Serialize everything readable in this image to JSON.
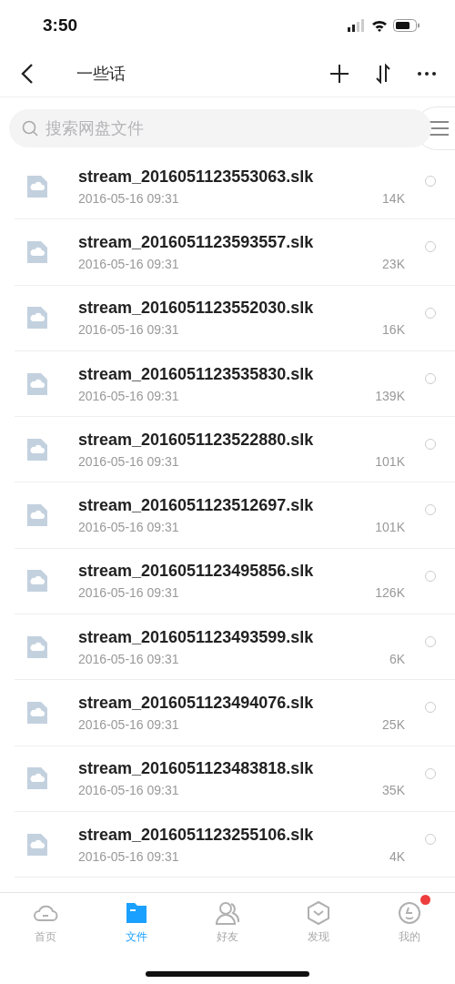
{
  "status_bar": {
    "time": "3:50"
  },
  "nav_bar": {
    "title": "一些话"
  },
  "search": {
    "placeholder": "搜索网盘文件"
  },
  "files": [
    {
      "name": "stream_2016051123553063.slk",
      "date": "2016-05-16 09:31",
      "size": "14K",
      "selected": false
    },
    {
      "name": "stream_2016051123593557.slk",
      "date": "2016-05-16 09:31",
      "size": "23K",
      "selected": false
    },
    {
      "name": "stream_2016051123552030.slk",
      "date": "2016-05-16 09:31",
      "size": "16K",
      "selected": false
    },
    {
      "name": "stream_2016051123535830.slk",
      "date": "2016-05-16 09:31",
      "size": "139K",
      "selected": false
    },
    {
      "name": "stream_2016051123522880.slk",
      "date": "2016-05-16 09:31",
      "size": "101K",
      "selected": false
    },
    {
      "name": "stream_2016051123512697.slk",
      "date": "2016-05-16 09:31",
      "size": "101K",
      "selected": false
    },
    {
      "name": "stream_2016051123495856.slk",
      "date": "2016-05-16 09:31",
      "size": "126K",
      "selected": false
    },
    {
      "name": "stream_2016051123493599.slk",
      "date": "2016-05-16 09:31",
      "size": "6K",
      "selected": false
    },
    {
      "name": "stream_2016051123494076.slk",
      "date": "2016-05-16 09:31",
      "size": "25K",
      "selected": false
    },
    {
      "name": "stream_2016051123483818.slk",
      "date": "2016-05-16 09:31",
      "size": "35K",
      "selected": false
    },
    {
      "name": "stream_2016051123255106.slk",
      "date": "2016-05-16 09:31",
      "size": "4K",
      "selected": false
    }
  ],
  "tab_bar": [
    {
      "label": "首页",
      "kind": "home",
      "selected": false,
      "badge": false
    },
    {
      "label": "文件",
      "kind": "files",
      "selected": true,
      "badge": false
    },
    {
      "label": "好友",
      "kind": "friends",
      "selected": false,
      "badge": false
    },
    {
      "label": "发现",
      "kind": "discover",
      "selected": false,
      "badge": false
    },
    {
      "label": "我的",
      "kind": "me",
      "selected": false,
      "badge": true
    }
  ]
}
